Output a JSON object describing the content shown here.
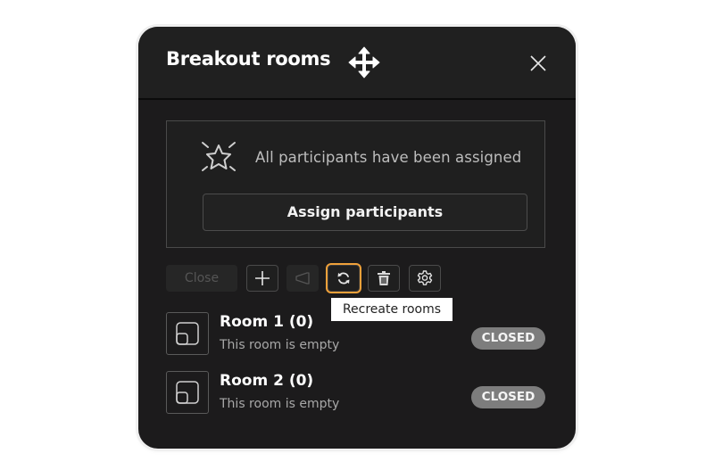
{
  "dialog": {
    "title": "Breakout rooms",
    "icons": {
      "move": "move-arrows-icon",
      "close": "close-x-icon"
    }
  },
  "assignment": {
    "status_text": "All participants have been assigned",
    "status_icon": "sparkle-star-icon",
    "assign_button_label": "Assign participants"
  },
  "toolbar": {
    "close_label": "Close",
    "buttons": [
      {
        "name": "add-room",
        "icon": "plus-icon",
        "enabled": true
      },
      {
        "name": "broadcast",
        "icon": "megaphone-icon",
        "enabled": false
      },
      {
        "name": "recreate-rooms",
        "icon": "refresh-icon",
        "enabled": true,
        "focused": true
      },
      {
        "name": "delete-rooms",
        "icon": "trash-icon",
        "enabled": true
      },
      {
        "name": "settings",
        "icon": "gear-icon",
        "enabled": true
      }
    ],
    "tooltip": "Recreate rooms",
    "focus_color": "#f0a13a"
  },
  "rooms": [
    {
      "name": "Room 1 (0)",
      "subtitle": "This room is empty",
      "status": "CLOSED"
    },
    {
      "name": "Room 2 (0)",
      "subtitle": "This room is empty",
      "status": "CLOSED"
    }
  ]
}
